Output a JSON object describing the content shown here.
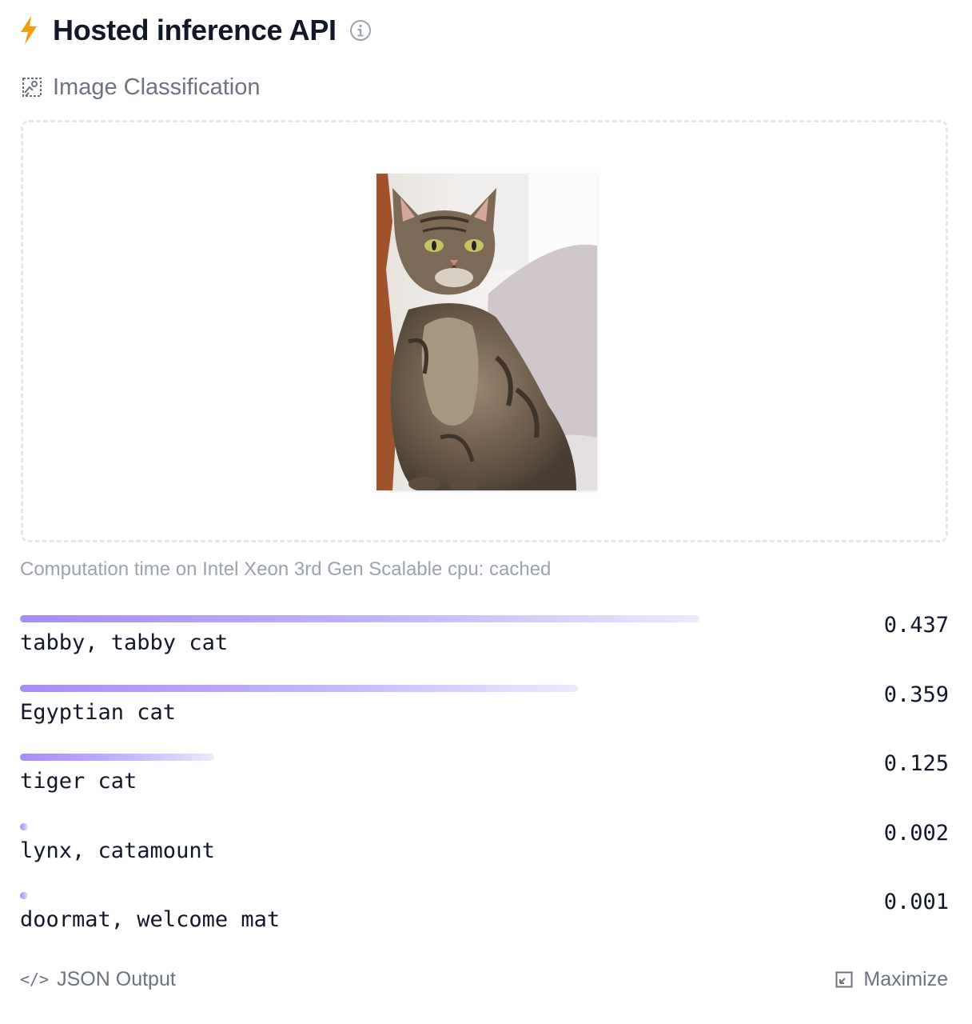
{
  "header": {
    "title": "Hosted inference API"
  },
  "task": {
    "label": "Image Classification"
  },
  "computation": {
    "text": "Computation time on Intel Xeon 3rd Gen Scalable cpu: cached"
  },
  "results": [
    {
      "label": "tabby, tabby cat",
      "score": "0.437",
      "fraction": 0.437
    },
    {
      "label": "Egyptian cat",
      "score": "0.359",
      "fraction": 0.359
    },
    {
      "label": "tiger cat",
      "score": "0.125",
      "fraction": 0.125
    },
    {
      "label": "lynx, catamount",
      "score": "0.002",
      "fraction": 0.002
    },
    {
      "label": "doormat, welcome mat",
      "score": "0.001",
      "fraction": 0.001
    }
  ],
  "footer": {
    "json_label": "JSON Output",
    "maximize_label": "Maximize"
  },
  "colors": {
    "accent": "#a78bfa",
    "bolt": "#f59e0b",
    "muted": "#6b7280"
  }
}
